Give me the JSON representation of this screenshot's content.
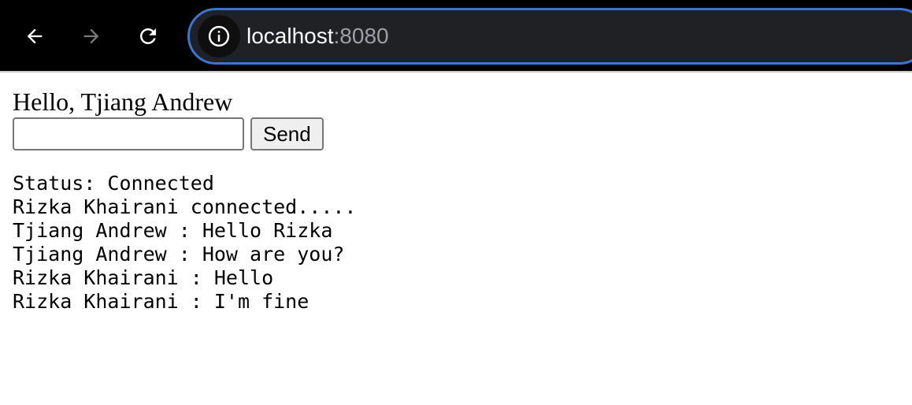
{
  "browser": {
    "url_host": "localhost",
    "url_port": ":8080"
  },
  "page": {
    "greeting": "Hello, Tjiang Andrew",
    "input_value": "",
    "send_label": "Send",
    "status": "Status: Connected",
    "messages": [
      "Rizka Khairani connected.....",
      "Tjiang Andrew : Hello Rizka",
      "Tjiang Andrew : How are you?",
      "Rizka Khairani : Hello",
      "Rizka Khairani : I'm fine"
    ]
  },
  "icons": {
    "back": "arrow-back-icon",
    "forward": "arrow-forward-icon",
    "reload": "reload-icon",
    "info": "info-icon"
  }
}
